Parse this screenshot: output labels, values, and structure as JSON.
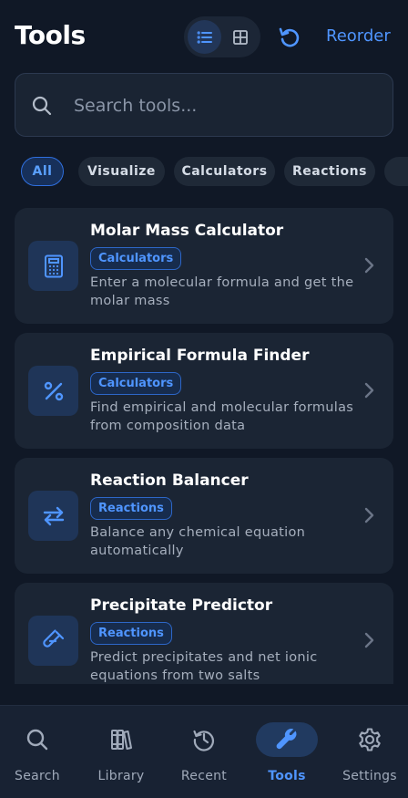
{
  "header": {
    "title": "Tools",
    "reorder_label": "Reorder"
  },
  "search": {
    "placeholder": "Search tools..."
  },
  "filters": [
    {
      "label": "All",
      "active": true
    },
    {
      "label": "Visualize"
    },
    {
      "label": "Calculators"
    },
    {
      "label": "Reactions"
    }
  ],
  "tools": [
    {
      "title": "Molar Mass Calculator",
      "badge": "Calculators",
      "description": "Enter a molecular formula and get the molar mass",
      "icon": "calculator-icon"
    },
    {
      "title": "Empirical Formula Finder",
      "badge": "Calculators",
      "description": "Find empirical and molecular formulas from composition data",
      "icon": "percent-icon"
    },
    {
      "title": "Reaction Balancer",
      "badge": "Reactions",
      "description": "Balance any chemical equation automatically",
      "icon": "arrows-exchange-icon"
    },
    {
      "title": "Precipitate Predictor",
      "badge": "Reactions",
      "description": "Predict precipitates and net ionic equations from two salts",
      "icon": "test-tube-icon"
    }
  ],
  "nav": [
    {
      "label": "Search",
      "icon": "search-icon"
    },
    {
      "label": "Library",
      "icon": "books-icon"
    },
    {
      "label": "Recent",
      "icon": "history-icon"
    },
    {
      "label": "Tools",
      "icon": "wrench-icon",
      "active": true
    },
    {
      "label": "Settings",
      "icon": "gear-icon"
    }
  ],
  "colors": {
    "background": "#101826",
    "card": "#1b2534",
    "accent": "#4f95ff"
  }
}
